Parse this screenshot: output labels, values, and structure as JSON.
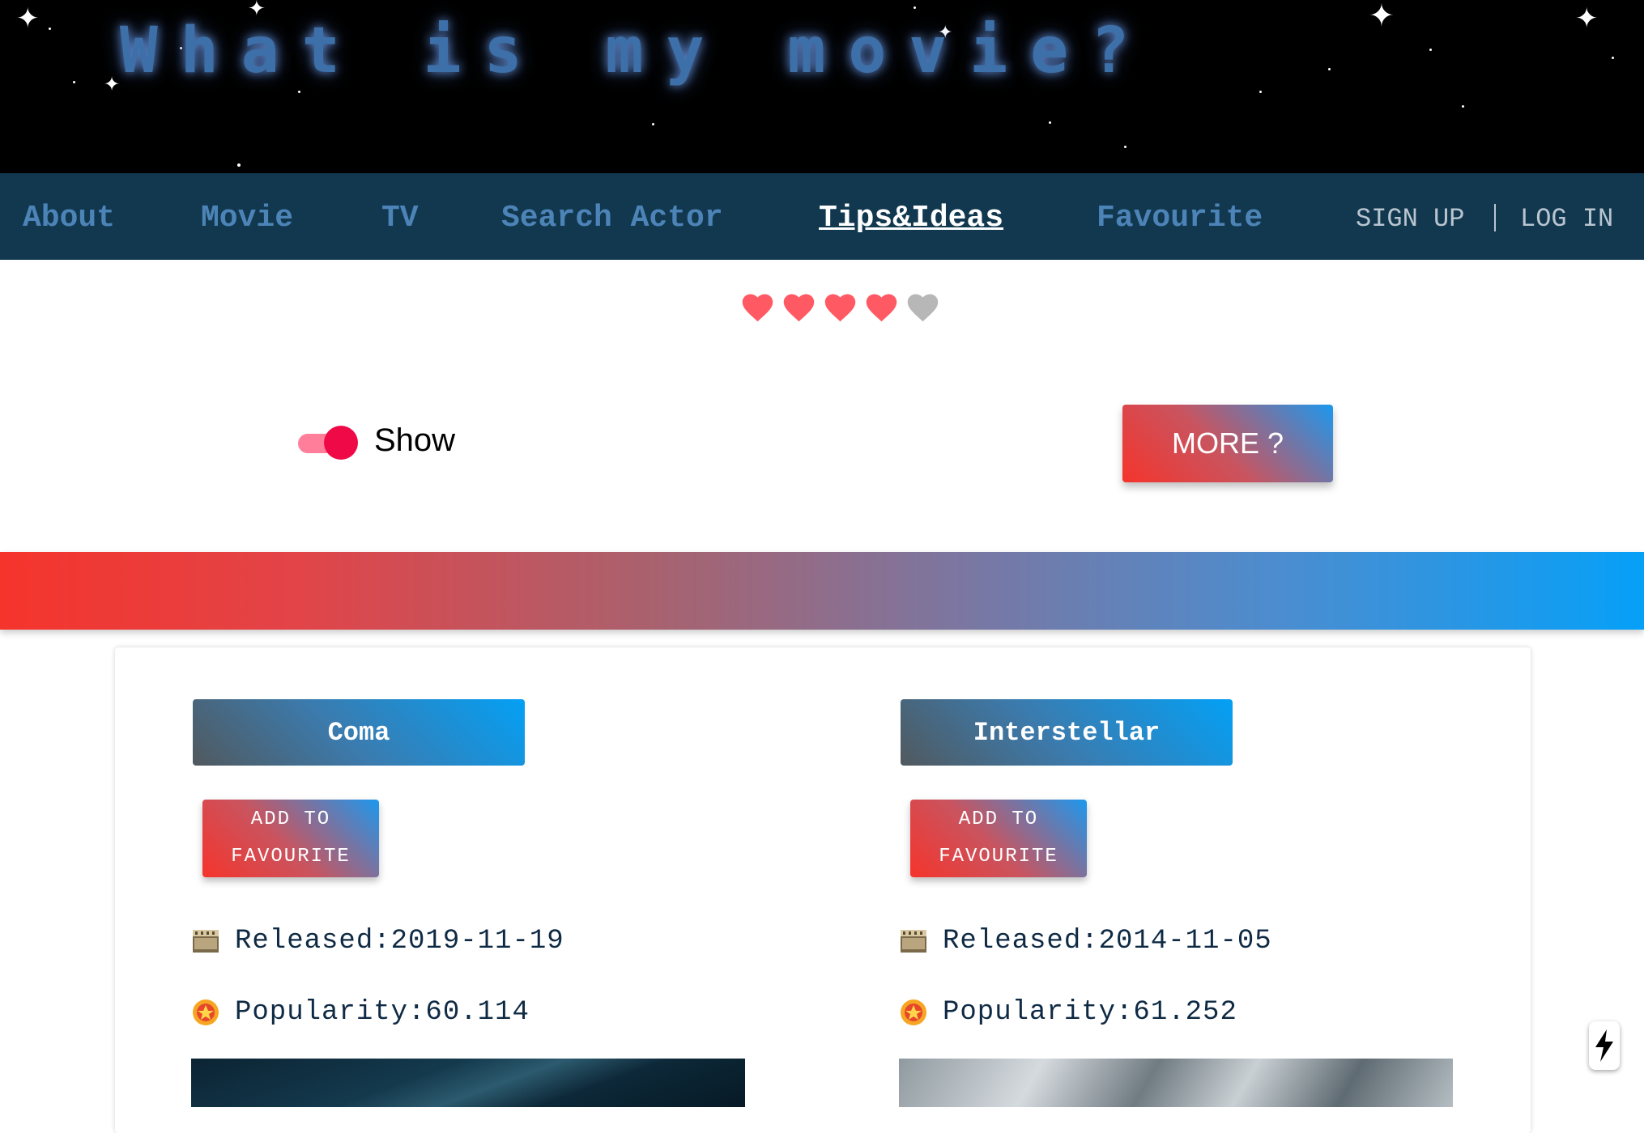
{
  "header": {
    "title": "What is my movie?"
  },
  "nav": {
    "items": [
      {
        "label": "About"
      },
      {
        "label": "Movie"
      },
      {
        "label": "TV"
      },
      {
        "label": "Search Actor"
      },
      {
        "label": "Tips&Ideas",
        "active": true
      },
      {
        "label": "Favourite"
      }
    ],
    "signup_label": "SIGN UP",
    "login_label": "LOG IN"
  },
  "rating": {
    "filled_hearts": 4,
    "total_hearts": 5
  },
  "controls": {
    "toggle_label": "Show",
    "toggle_on": true,
    "more_label": "MORE ?"
  },
  "movies": [
    {
      "title": "Coma",
      "fav_line1": "ADD TO",
      "fav_line2": "FAVOURITE",
      "released": "Released:2019-11-19",
      "popularity": "Popularity:60.114"
    },
    {
      "title": "Interstellar",
      "fav_line1": "ADD TO",
      "fav_line2": "FAVOURITE",
      "released": "Released:2014-11-05",
      "popularity": "Popularity:61.252"
    }
  ],
  "colors": {
    "nav_bg": "#11384f",
    "nav_text": "#4d84b8",
    "heart_filled": "#ff5a64",
    "heart_empty": "#b7b7b7",
    "toggle_track": "#ff7f9a",
    "toggle_knob": "#ef0a47"
  }
}
